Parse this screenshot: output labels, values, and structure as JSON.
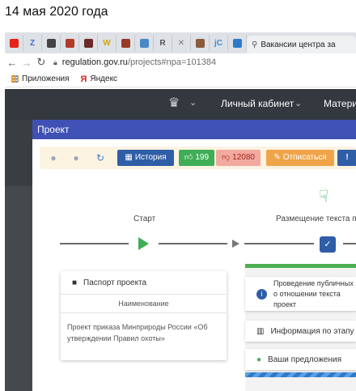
{
  "caption": "14 мая 2020 года",
  "browser": {
    "fav_tabs": [
      {
        "icon": "youtube-icon",
        "color": "#e62117"
      },
      {
        "icon": "z-icon",
        "color": "#3b6fd6",
        "glyph": "Z"
      },
      {
        "icon": "owl-icon",
        "color": "#444"
      },
      {
        "icon": "bookmark-red-icon",
        "color": "#b23a2a"
      },
      {
        "icon": "block-icon",
        "color": "#6b2a2a"
      },
      {
        "icon": "w-icon",
        "color": "#d8a500",
        "glyph": "W"
      },
      {
        "icon": "shield-icon",
        "color": "#9a3b2a"
      },
      {
        "icon": "image-icon",
        "color": "#4a88c7"
      },
      {
        "icon": "r-icon",
        "color": "#555",
        "glyph": "R"
      },
      {
        "icon": "x-icon",
        "color": "#777",
        "glyph": "✕"
      },
      {
        "icon": "coin-icon",
        "color": "#8a5b3a"
      },
      {
        "icon": "jc-icon",
        "color": "#3a8ed6",
        "glyph": "jC"
      },
      {
        "icon": "c-icon",
        "color": "#2f79c9"
      }
    ],
    "active_tab_title": "Вакансии центра за",
    "url_domain": "regulation.gov.ru",
    "url_path": "/projects#npa=101384",
    "bookmarks": {
      "apps_label": "Приложения",
      "yandex_label": "Яндекс"
    }
  },
  "site_header": {
    "cabinet_label": "Личный кабинет",
    "materials_label": "Матери"
  },
  "project": {
    "title": "Проект",
    "toolbar": {
      "history_label": "История",
      "likes": "199",
      "dislikes": "12080",
      "unsubscribe_label": "Отписаться"
    },
    "steps": {
      "start_label": "Старт",
      "placement_label": "Размещение текста п"
    },
    "passport": {
      "title": "Паспорт проекта",
      "name_header": "Наименование",
      "name_value": "Проект приказа Минприроды России «Об утверждении Правил охоты»"
    },
    "right_panel": {
      "public_discussion": "Проведение публичных о отношении текста проект",
      "stage_info": "Информация по этапу",
      "your_proposals": "Ваши предложения"
    }
  }
}
